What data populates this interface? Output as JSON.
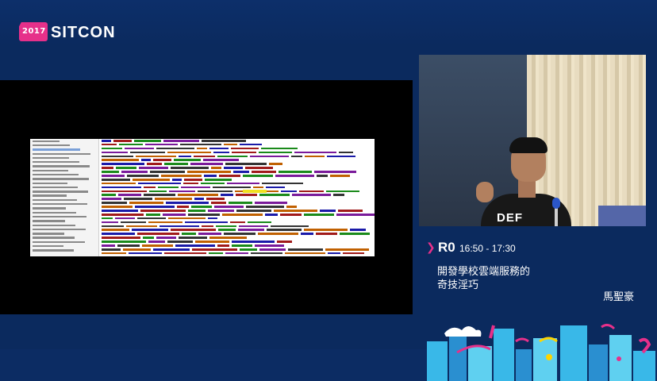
{
  "logo": {
    "year": "2017",
    "name": "SITCON"
  },
  "session": {
    "room": "R0",
    "time": "16:50 - 17:30",
    "title_line1": "開發學校雲端服務的",
    "title_line2": "奇技淫巧",
    "speaker": "馬聖豪"
  },
  "video": {
    "shirt_text": "DEF"
  },
  "icons": {
    "room_marker": "chevron-right-icon"
  },
  "colors": {
    "background": "#0b2a5e",
    "accent": "#e6308a",
    "text": "#ffffff",
    "screen": "#000000"
  }
}
